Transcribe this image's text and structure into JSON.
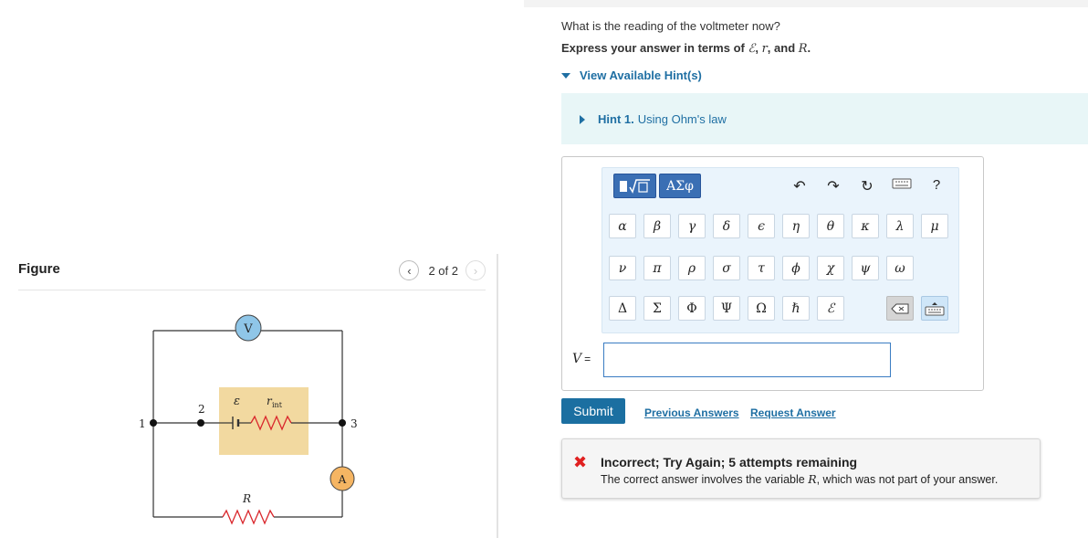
{
  "figure": {
    "title": "Figure",
    "pager_text": "2 of 2",
    "circuit_labels": {
      "voltmeter": "V",
      "ammeter": "A",
      "emf": "ε",
      "r_int": "r",
      "r_int_sub": "int",
      "resistor": "R",
      "node1": "1",
      "node2": "2",
      "node3": "3"
    }
  },
  "question": {
    "prompt": "What is the reading of the voltmeter now?",
    "express_prefix": "Express your answer in terms of ",
    "var1": "ℰ",
    "sep1": ", ",
    "var2": "r",
    "sep2": ", and ",
    "var3": "R",
    "suffix": "."
  },
  "hints": {
    "toggle_label": "View Available Hint(s)",
    "hint1_prefix": "Hint 1.",
    "hint1_title": "Using Ohm's law"
  },
  "editor": {
    "toolbar": {
      "templates_icon": "fraction-sqrt-templates-icon",
      "greek_label": "ΑΣφ",
      "undo_icon": "undo-icon",
      "redo_icon": "redo-icon",
      "reset_icon": "reset-icon",
      "keyboard_icon": "keyboard-icon",
      "help_label": "?"
    },
    "row1": [
      "α",
      "β",
      "γ",
      "δ",
      "ϵ",
      "η",
      "θ",
      "κ",
      "λ",
      "μ"
    ],
    "row2": [
      "ν",
      "π",
      "ρ",
      "σ",
      "τ",
      "ϕ",
      "χ",
      "ψ",
      "ω"
    ],
    "row3": [
      "Δ",
      "Σ",
      "Φ",
      "Ψ",
      "Ω",
      "ℏ",
      "ℰ"
    ],
    "answer_label": "V",
    "answer_equals": "=",
    "answer_value": ""
  },
  "actions": {
    "submit": "Submit",
    "previous_answers": "Previous Answers",
    "request_answer": "Request Answer"
  },
  "feedback": {
    "title": "Incorrect; Try Again; 5 attempts remaining",
    "message_prefix": "The correct answer involves the variable ",
    "message_var": "R",
    "message_suffix": ", which was not part of your answer."
  },
  "colors": {
    "link_blue": "#1f6fa3",
    "submit_bg": "#1b6fa1",
    "hint_bg": "#e8f6f7",
    "error_red": "#e02020",
    "voltmeter_fill": "#8fc6e8",
    "ammeter_fill": "#f5b563",
    "battery_box": "#f2d9a0",
    "resistor_red": "#d9262b"
  }
}
